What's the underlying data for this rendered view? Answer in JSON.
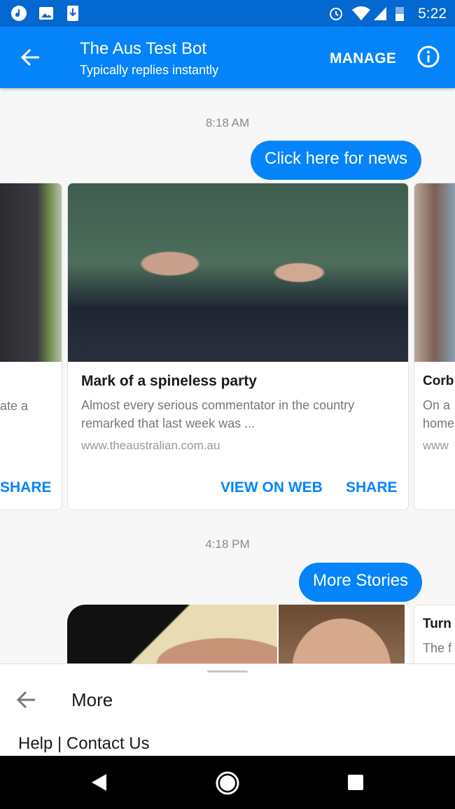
{
  "status_bar": {
    "time": "5:22",
    "icons": [
      "music-icon",
      "image-icon",
      "download-icon",
      "alarm-icon",
      "wifi-icon",
      "signal-icon",
      "battery-icon"
    ]
  },
  "header": {
    "title": "The Aus Test Bot",
    "subtitle": "Typically replies instantly",
    "manage_label": "MANAGE",
    "icons": [
      "back-arrow-icon",
      "info-icon"
    ]
  },
  "messages": [
    {
      "timestamp": "8:18 AM",
      "bubble": "Click here for news"
    },
    {
      "timestamp": "4:18 PM",
      "bubble": "More Stories"
    }
  ],
  "carousel1": {
    "left_card": {
      "desc": "ate a",
      "share": "SHARE"
    },
    "main_card": {
      "title": "Mark of a spineless party",
      "desc1": "Almost every serious commentator in the country",
      "desc2": "remarked that last week was ...",
      "url": "www.theaustralian.com.au",
      "view_label": "VIEW ON WEB",
      "share_label": "SHARE"
    },
    "right_card": {
      "title": "Corb",
      "desc1": "On a",
      "desc2": "home",
      "url": "www"
    }
  },
  "carousel2": {
    "right_card": {
      "title": "Turn",
      "desc1": "The f"
    }
  },
  "bottom_sheet": {
    "title": "More",
    "item": "Help | Contact Us"
  },
  "colors": {
    "accent": "#0584f9",
    "status_bar": "#0368cf"
  }
}
